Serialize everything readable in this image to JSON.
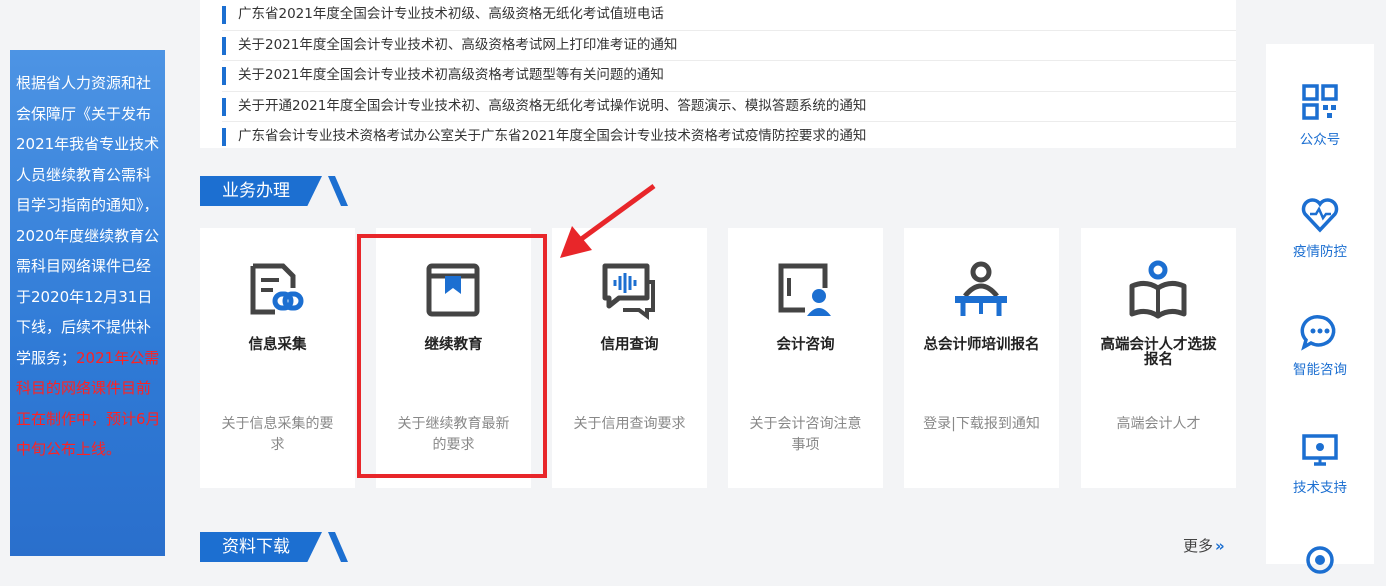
{
  "left_notice": {
    "text_blue": "根据省人力资源和社会保障厅《关于发布2021年我省专业技术人员继续教育公需科目学习指南的通知》，2020年度继续教育公需科目网络课件已经于2020年12月31日下线，后续不提供补学服务；",
    "text_red": "2021年公需科目的网络课件目前正在制作中，预计6月中旬公布上线。"
  },
  "news": [
    "广东省2021年度全国会计专业技术初级、高级资格无纸化考试值班电话",
    "关于2021年度全国会计专业技术初、高级资格考试网上打印准考证的通知",
    "关于2021年度全国会计专业技术初高级资格考试题型等有关问题的通知",
    "关于开通2021年度全国会计专业技术初、高级资格无纸化考试操作说明、答题演示、模拟答题系统的通知",
    "广东省会计专业技术资格考试办公室关于广东省2021年度全国会计专业技术资格考试疫情防控要求的通知"
  ],
  "section_business": {
    "title": "业务办理"
  },
  "section_download": {
    "title": "资料下载",
    "more": "更多"
  },
  "cards": [
    {
      "icon": "document-link-icon",
      "title": "信息采集",
      "desc": "关于信息采集的要求"
    },
    {
      "icon": "book-bookmark-icon",
      "title": "继续教育",
      "desc": "关于继续教育最新的要求"
    },
    {
      "icon": "voice-chat-icon",
      "title": "信用查询",
      "desc": "关于信用查询要求"
    },
    {
      "icon": "id-card-user-icon",
      "title": "会计咨询",
      "desc": "关于会计咨询注意事项"
    },
    {
      "icon": "lecturer-desk-icon",
      "title": "总会计师培训报名",
      "desc": "登录|下载报到通知"
    },
    {
      "icon": "reader-book-icon",
      "title": "高端会计人才选拔报名",
      "desc": "高端会计人才"
    }
  ],
  "right_bar": [
    {
      "icon": "qrcode-icon",
      "label": "公众号"
    },
    {
      "icon": "heart-health-icon",
      "label": "疫情防控"
    },
    {
      "icon": "chat-bubble-icon",
      "label": "智能咨询"
    },
    {
      "icon": "monitor-support-icon",
      "label": "技术支持"
    }
  ],
  "colors": {
    "accent": "#1c6fd1",
    "highlight": "#e8262a",
    "alert_text": "#ff2222"
  }
}
